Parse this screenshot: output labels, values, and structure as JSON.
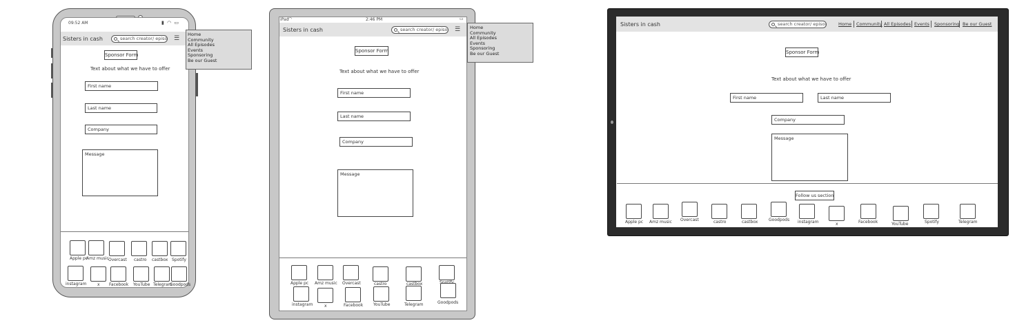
{
  "app": {
    "title": "Sisters in cash",
    "search_placeholder": "search creator/ episode",
    "menu_icon": "hamburger-menu-icon"
  },
  "nav": {
    "items": [
      "Home",
      "Community",
      "All Episodes",
      "Events",
      "Sponsoring",
      "Be our Guest"
    ]
  },
  "form": {
    "heading": "Sponsor Form",
    "intro": "Text about what we have to offer",
    "first_name": "First name",
    "last_name": "Last name",
    "company": "Company",
    "message": "Message"
  },
  "apps": {
    "row1": [
      "Apple pc",
      "Amz music",
      "Overcast",
      "castro",
      "castbox",
      "Spotify"
    ],
    "row2": [
      "instagram",
      "x",
      "Facebook",
      "YouTube",
      "Telegram",
      "Goodpods"
    ],
    "desktop": [
      "Apple pc",
      "Amz music",
      "Overcast",
      "castro",
      "castbox",
      "Goodpods",
      "instagram",
      "x",
      "Facebook",
      "YouTube",
      "Spotify",
      "Telegram"
    ]
  },
  "desktop": {
    "follow_label": "Follow us section"
  },
  "phone": {
    "status_time": "09:52 AM"
  },
  "tablet": {
    "status_device": "iPad",
    "status_time": "2:46 PM"
  }
}
